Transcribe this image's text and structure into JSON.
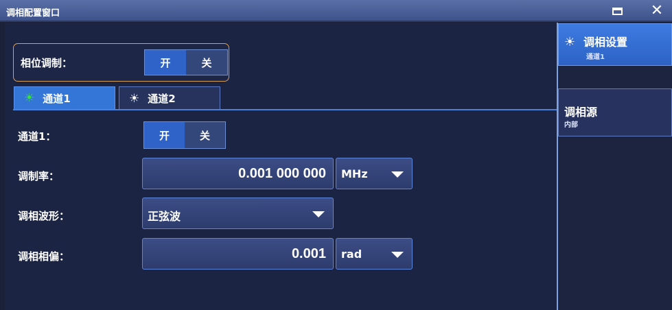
{
  "window": {
    "title": "调相配置窗口",
    "close_glyph": "✕"
  },
  "phase_modulation": {
    "label": "相位调制：",
    "on_label": "开",
    "off_label": "关"
  },
  "tabs": [
    {
      "label": "通道1",
      "icon": "sun-icon",
      "icon_glyph": "☀",
      "icon_color": "#39e339",
      "active": true
    },
    {
      "label": "通道2",
      "icon": "sun-icon",
      "icon_glyph": "☀",
      "icon_color": "#ffffff",
      "active": false
    }
  ],
  "channel": {
    "label": "通道1：",
    "on_label": "开",
    "off_label": "关"
  },
  "mod_rate": {
    "label": "调制率：",
    "value": "0.001 000 000",
    "unit": "MHz"
  },
  "waveform": {
    "label": "调相波形：",
    "value": "正弦波"
  },
  "deviation": {
    "label": "调相相偏：",
    "value": "0.001",
    "unit": "rad"
  },
  "right_panel": {
    "items": [
      {
        "label": "调相设置",
        "sub": "通道1",
        "icon_glyph": "☀"
      },
      {
        "label": "调相源",
        "sub": "内部"
      }
    ]
  },
  "colors": {
    "accent_blue": "#3475d8",
    "highlight_orange": "#d89f5a",
    "active_green": "#39e339"
  }
}
